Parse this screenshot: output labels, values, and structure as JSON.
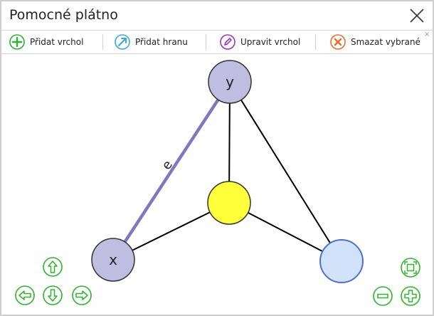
{
  "window": {
    "title": "Pomocné plátno"
  },
  "toolbar": {
    "add_vertex_label": "Přidat vrchol",
    "add_edge_label": "Přidat hranu",
    "edit_vertex_label": "Upravit vrchol",
    "delete_selected_label": "Smazat vybrané",
    "dismiss_glyph": "×"
  },
  "graph": {
    "vertices": [
      {
        "id": "y",
        "label": "y",
        "fill": "#bfbde0"
      },
      {
        "id": "x",
        "label": "x",
        "fill": "#bfbde0"
      },
      {
        "id": "c",
        "label": "",
        "fill": "#ffff3a"
      },
      {
        "id": "r",
        "label": "",
        "fill": "#d2e2fb"
      }
    ],
    "edges": [
      {
        "from": "x",
        "to": "y",
        "label": "e",
        "selected": true
      },
      {
        "from": "y",
        "to": "c",
        "label": "",
        "selected": false
      },
      {
        "from": "y",
        "to": "r",
        "label": "",
        "selected": false
      },
      {
        "from": "x",
        "to": "c",
        "label": "",
        "selected": false
      },
      {
        "from": "c",
        "to": "r",
        "label": "",
        "selected": false
      }
    ]
  },
  "colors": {
    "add": "#2bb52b",
    "edge_tool": "#35a9e0",
    "edit": "#a12fc0",
    "delete": "#ee6a2a",
    "nav": "#2bb52b",
    "selected_edge": "#8078be",
    "edge": "#000000",
    "selected_vertex_stroke": "#4a72d6"
  }
}
